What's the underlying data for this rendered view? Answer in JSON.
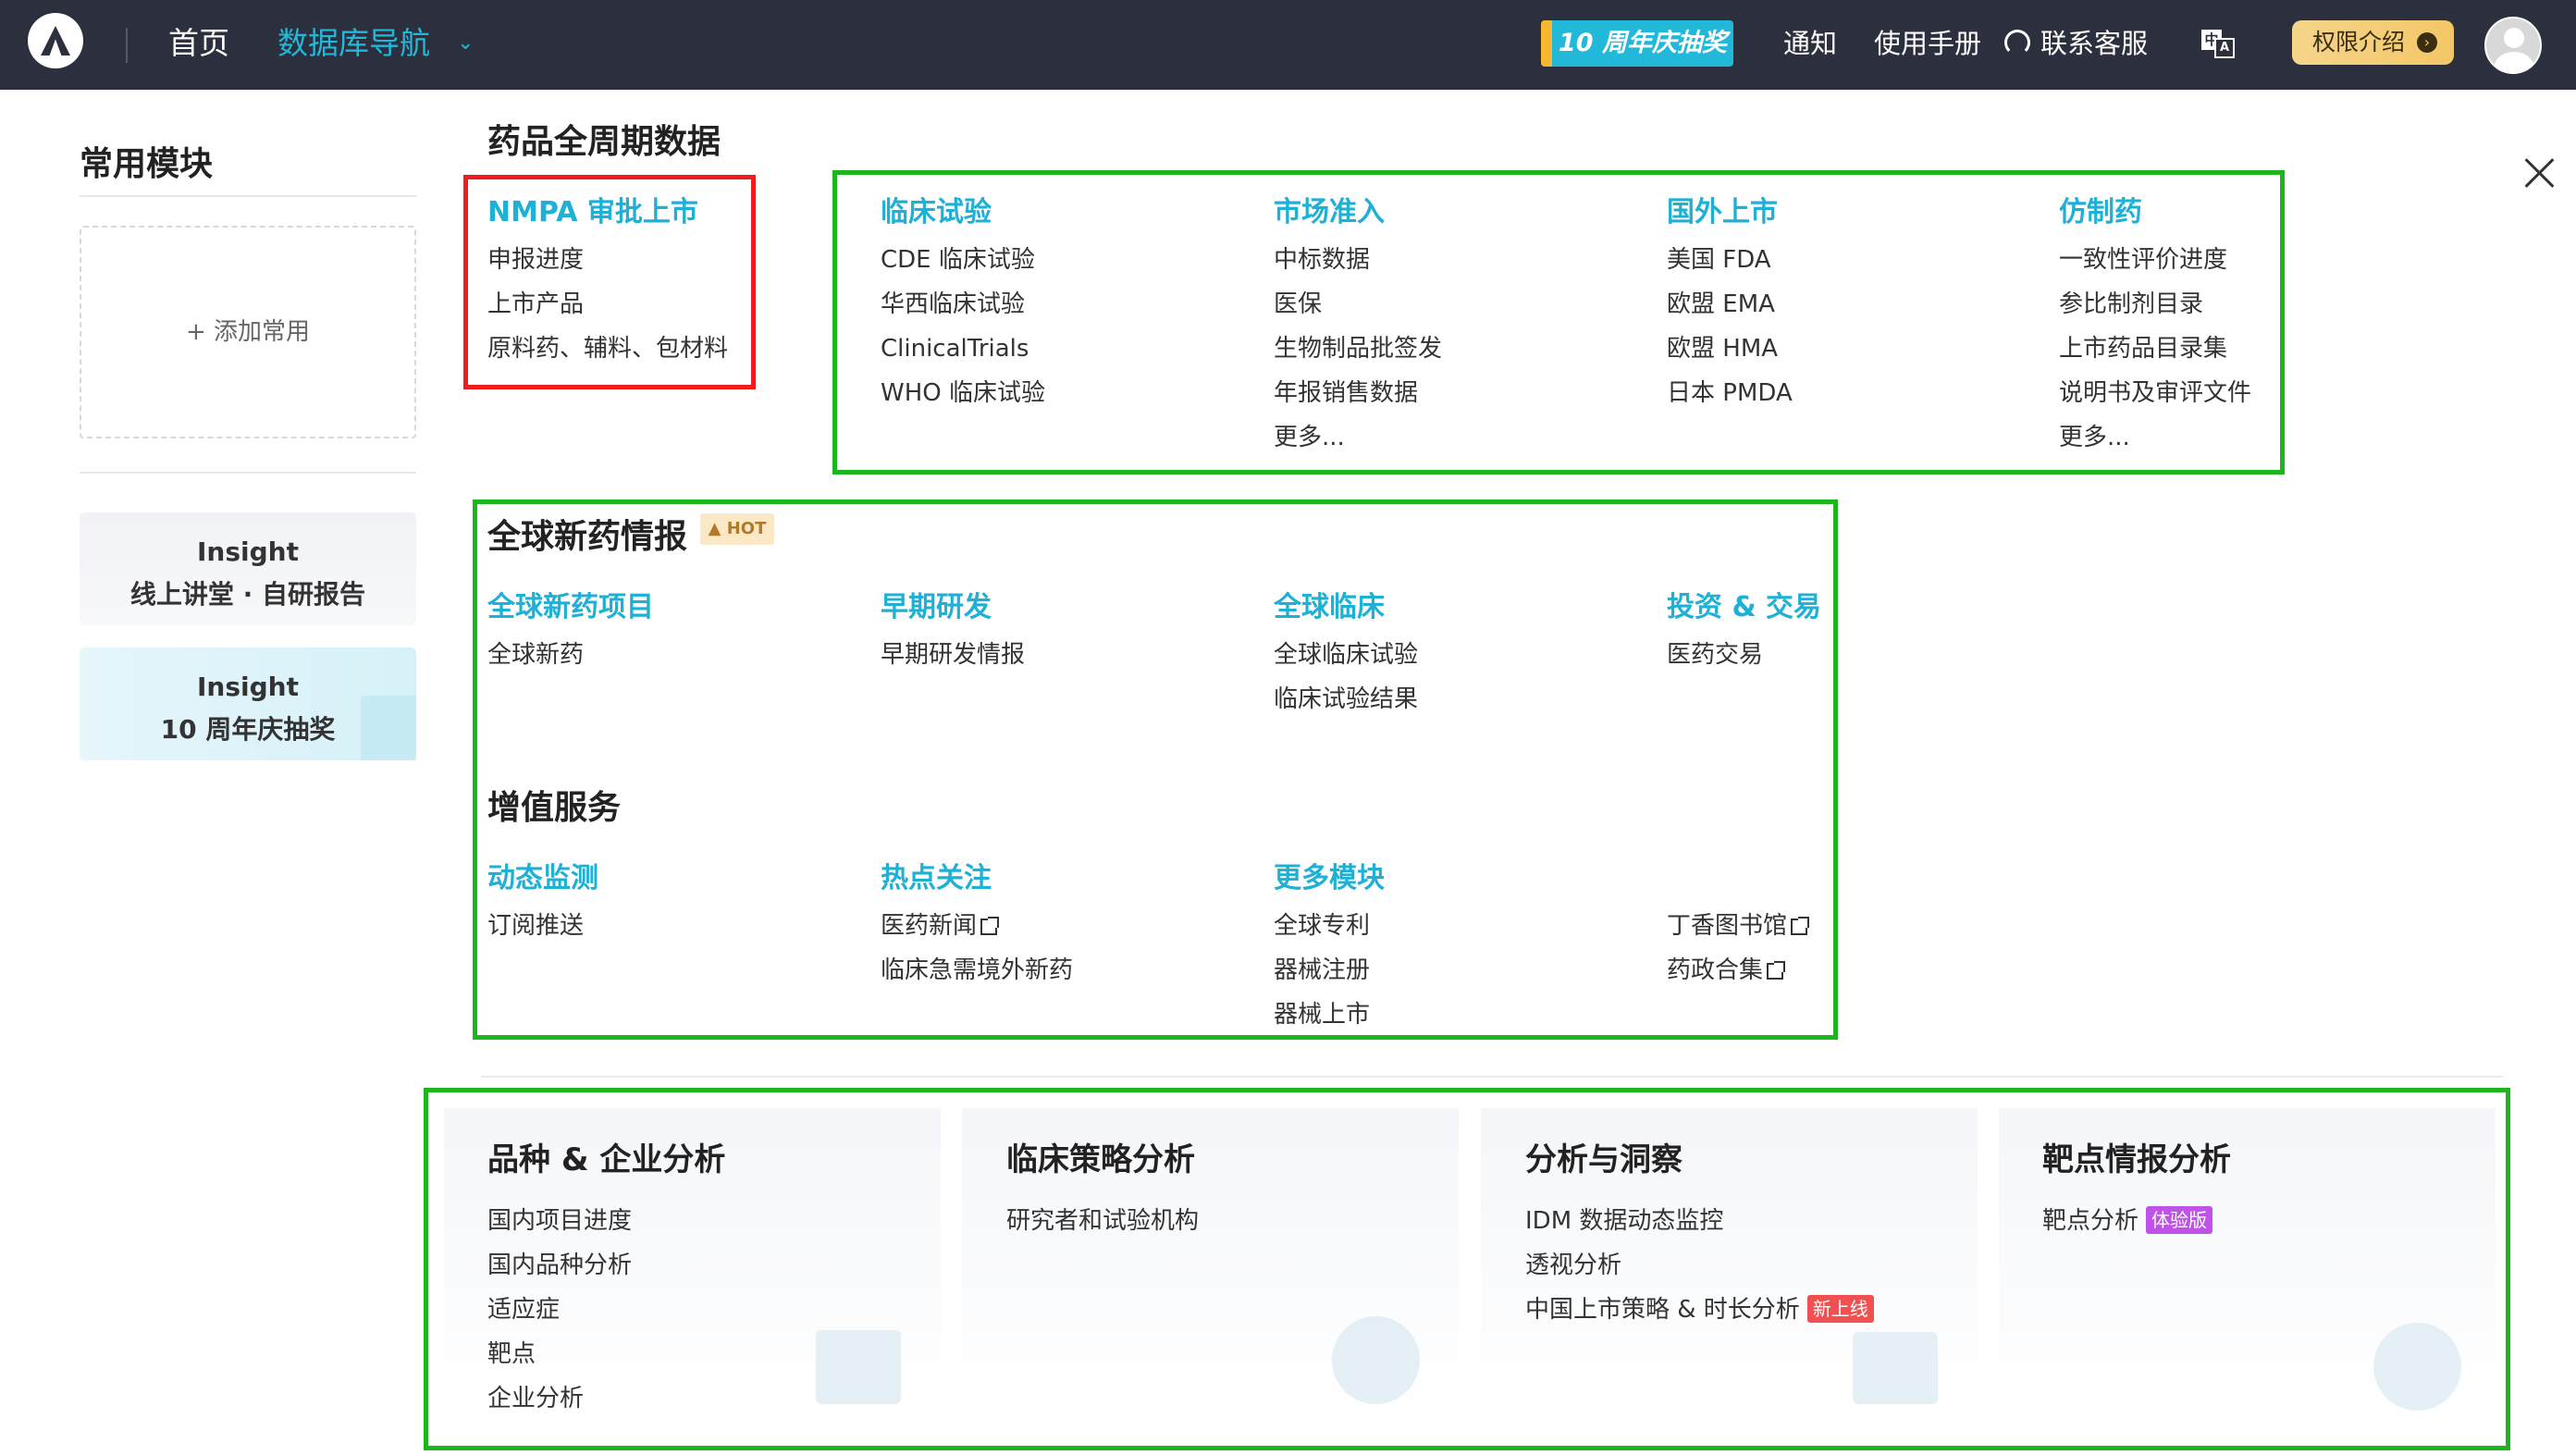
{
  "topbar": {
    "home": "首页",
    "db_nav": "数据库导航",
    "anniversary": "10 周年庆抽奖",
    "notice": "通知",
    "manual": "使用手册",
    "service": "联系客服",
    "auth": "权限介绍"
  },
  "left": {
    "title": "常用模块",
    "add": "+ 添加常用",
    "insight1": {
      "line1": "Insight",
      "line2": "线上讲堂 · 自研报告"
    },
    "insight2": {
      "line1": "Insight",
      "line2": "10 周年庆抽奖"
    }
  },
  "drug": {
    "title": "药品全周期数据",
    "nmpa": {
      "title": "NMPA 审批上市",
      "items": [
        "申报进度",
        "上市产品",
        "原料药、辅料、包材料"
      ]
    },
    "clinical": {
      "title": "临床试验",
      "items": [
        "CDE 临床试验",
        "华西临床试验",
        "ClinicalTrials",
        "WHO 临床试验"
      ]
    },
    "market": {
      "title": "市场准入",
      "items": [
        "中标数据",
        "医保",
        "生物制品批签发",
        "年报销售数据",
        "更多..."
      ]
    },
    "foreign": {
      "title": "国外上市",
      "items": [
        "美国 FDA",
        "欧盟 EMA",
        "欧盟 HMA",
        "日本 PMDA"
      ]
    },
    "generic": {
      "title": "仿制药",
      "items": [
        "一致性评价进度",
        "参比制剂目录",
        "上市药品目录集",
        "说明书及审评文件",
        "更多..."
      ]
    }
  },
  "global": {
    "title": "全球新药情报",
    "hot": "HOT",
    "project": {
      "title": "全球新药项目",
      "items": [
        "全球新药"
      ]
    },
    "early": {
      "title": "早期研发",
      "items": [
        "早期研发情报"
      ]
    },
    "clinic": {
      "title": "全球临床",
      "items": [
        "全球临床试验",
        "临床试验结果"
      ]
    },
    "invest": {
      "title": "投资 & 交易",
      "items": [
        "医药交易"
      ]
    }
  },
  "value": {
    "title": "增值服务",
    "monitor": {
      "title": "动态监测",
      "items": [
        "订阅推送"
      ]
    },
    "hot": {
      "title": "热点关注",
      "items": [
        "医药新闻",
        "临床急需境外新药"
      ]
    },
    "more": {
      "title": "更多模块",
      "items": [
        "全球专利",
        "器械注册",
        "器械上市"
      ]
    },
    "extra": {
      "items": [
        "丁香图书馆",
        "药政合集"
      ]
    }
  },
  "analysis": [
    {
      "title": "品种 & 企业分析",
      "items": [
        "国内项目进度",
        "国内品种分析",
        "适应症",
        "靶点",
        "企业分析"
      ]
    },
    {
      "title": "临床策略分析",
      "items": [
        "研究者和试验机构"
      ]
    },
    {
      "title": "分析与洞察",
      "items": [
        "IDM 数据动态监控",
        "透视分析",
        "中国上市策略 & 时长分析"
      ],
      "tag": "新上线"
    },
    {
      "title": "靶点情报分析",
      "items": [
        "靶点分析"
      ],
      "tag": "体验版"
    }
  ],
  "colors": {
    "accent": "#1fb0d6",
    "topbar": "#2c2f3e",
    "red_box": "#ee1c1c",
    "green_box": "#1cb51c"
  }
}
